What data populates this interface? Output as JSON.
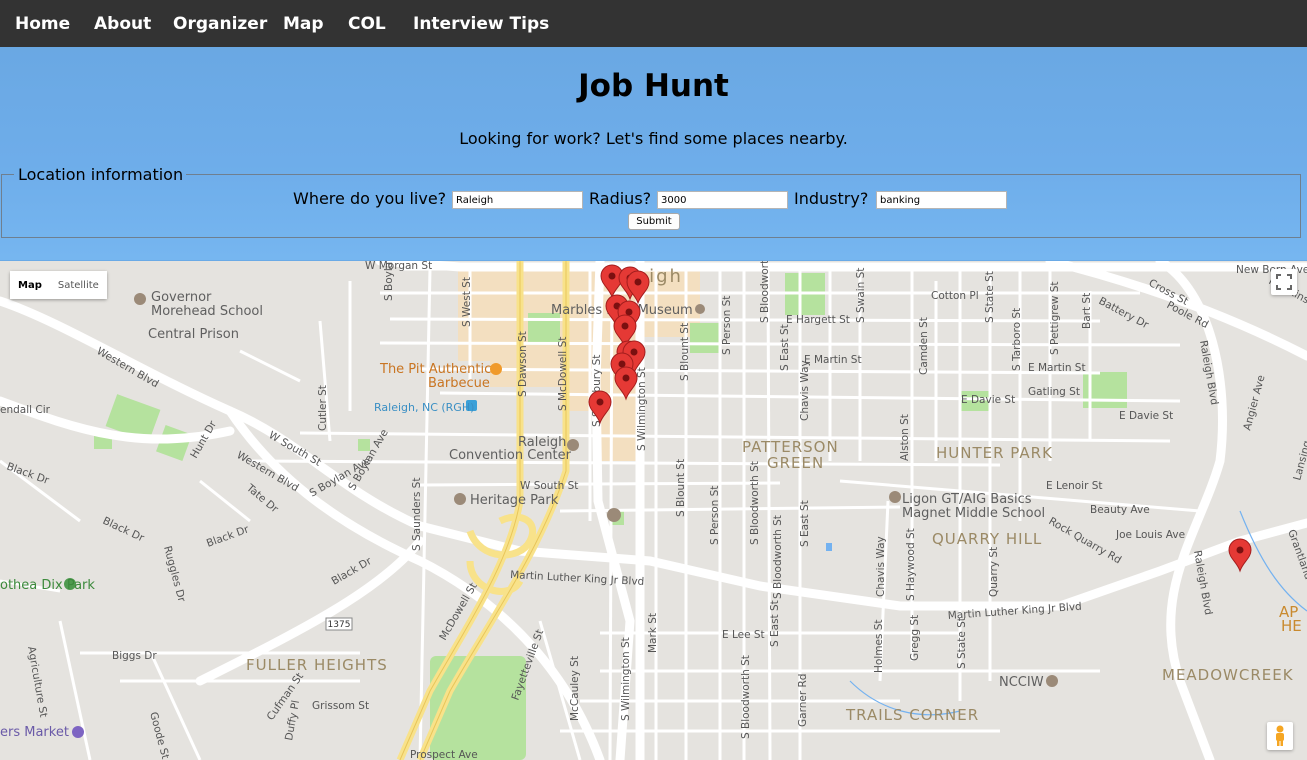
{
  "nav": {
    "items": [
      "Home",
      "About",
      "Organizer",
      "Map",
      "COL",
      "Interview Tips"
    ]
  },
  "header": {
    "title": "Job Hunt",
    "subtitle": "Looking for work? Let's find some places nearby."
  },
  "form": {
    "legend": "Location information",
    "location_label": "Where do you live?",
    "location_value": "Raleigh",
    "radius_label": "Radius?",
    "radius_value": "3000",
    "industry_label": "Industry?",
    "industry_value": "banking",
    "submit_label": "Submit"
  },
  "map": {
    "type_buttons": [
      "Map",
      "Satellite"
    ],
    "active_type": "Map",
    "pin_color": "#e53935",
    "pin_count": 12,
    "icons": [
      "fullscreen-icon",
      "pegman-icon",
      "map-pin-icon"
    ],
    "labels": {
      "governor": "Governor",
      "morehead": "Morehead School",
      "central_prison": "Central Prison",
      "marbles": "Marbles Kids Museum",
      "pit": "The Pit Authentic",
      "barbecue": "Barbecue",
      "rgh": "Raleigh, NC (RGH)",
      "raleigh_cc1": "Raleigh",
      "raleigh_cc2": "Convention Center",
      "heritage": "Heritage Park",
      "dix": "othea Dix Park",
      "market": "ers Market",
      "fuller": "FULLER HEIGHTS",
      "patterson1": "PATTERSON",
      "patterson2": "GREEN",
      "hunter": "HUNTER PARK",
      "ligon1": "Ligon GT/AIG Basics",
      "ligon2": "Magnet Middle School",
      "quarry": "QUARRY HILL",
      "nccw": "NCCIW",
      "meadow": "MEADOWCREEK",
      "trails": "TRAILS CORNER",
      "raleigh_top": "eigh",
      "ap": "AP",
      "he": "HE",
      "route": "1375",
      "streets": {
        "w_morgan": "W Morgan St",
        "new_bern": "New Bern Ave",
        "hawkins": "Hawkins St",
        "cotton": "Cotton Pl",
        "cross": "Cross St",
        "poole": "Poole Rd",
        "battery": "Battery Dr",
        "e_hargett": "E Hargett St",
        "e_martin": "E Martin St",
        "e_martin2": "E Martin St",
        "gatling": "Gatling St",
        "e_davie": "E Davie St",
        "e_davie2": "E Davie St",
        "e_lenoir": "E Lenoir St",
        "beauty": "Beauty Ave",
        "joe_louis": "Joe Louis Ave",
        "rock_quarry": "Rock Quarry Rd",
        "mlk": "Martin Luther King Jr Blvd",
        "mlk2": "Martin Luther King Jr Blvd",
        "e_lee": "E Lee St",
        "western": "Western Blvd",
        "western2": "Western Blvd",
        "w_south": "W South St",
        "w_south2": "W South St",
        "s_boylan": "S Boylan Ave",
        "boylan": "S Boylan Ave",
        "s_dawson": "S Dawson St",
        "s_mcdowell": "S McDowell St",
        "mcdowell": "McDowell St",
        "s_saunders": "S Saunders St",
        "s_wilmington": "S Wilmington St",
        "s_wilmington2": "S Wilmington St",
        "s_salisbury": "S Salisbury St",
        "s_blount": "S Blount St",
        "s_blount2": "S Blount St",
        "s_person": "S Person St",
        "s_person2": "S Person St",
        "s_bloodworth": "S Bloodworth St",
        "s_bloodworth2": "S Bloodworth St",
        "s_bloodworth3": "S Bloodworth St",
        "s_bloodworth4": "S Bloodworth St",
        "s_east": "S East St",
        "s_east2": "S East St",
        "s_east3": "S East St",
        "chavis": "Chavis Way",
        "chavis2": "Chavis Way",
        "s_swain": "S Swain St",
        "alston": "Alston St",
        "s_haywood": "S Haywood St",
        "quarry_st": "Quarry St",
        "camden": "Camden St",
        "s_state": "S State St",
        "s_state2": "S State St",
        "s_tarboro": "S Tarboro St",
        "s_pettigrew": "S Pettigrew St",
        "bart": "Bart St",
        "raleigh_blvd": "Raleigh Blvd",
        "raleigh_blvd2": "Raleigh Blvd",
        "angier": "Angier Ave",
        "lansing": "Lansing",
        "grantland": "Grantland Dr",
        "hunt": "Hunt Dr",
        "tate": "Tate Dr",
        "black": "Black Dr",
        "black2": "Black Dr",
        "black3": "Black Dr",
        "black4": "Black Dr",
        "ruggles": "Ruggles Dr",
        "biggs": "Biggs Dr",
        "agriculture": "Agriculture St",
        "goode": "Goode St",
        "cufman": "Cufman St",
        "grissom": "Grissom St",
        "duffy": "Duffy Pl",
        "fayetteville": "Fayetteville St",
        "mccauley": "McCauley St",
        "mark": "Mark St",
        "holmes": "Holmes St",
        "gregg": "Gregg St",
        "garner": "Garner Rd",
        "prospect": "Prospect Ave",
        "w_west": "S West St",
        "cutler": "Cutler St",
        "s_boylan3": "S Boylan Ave",
        "kendall": "endall Cir"
      }
    }
  }
}
